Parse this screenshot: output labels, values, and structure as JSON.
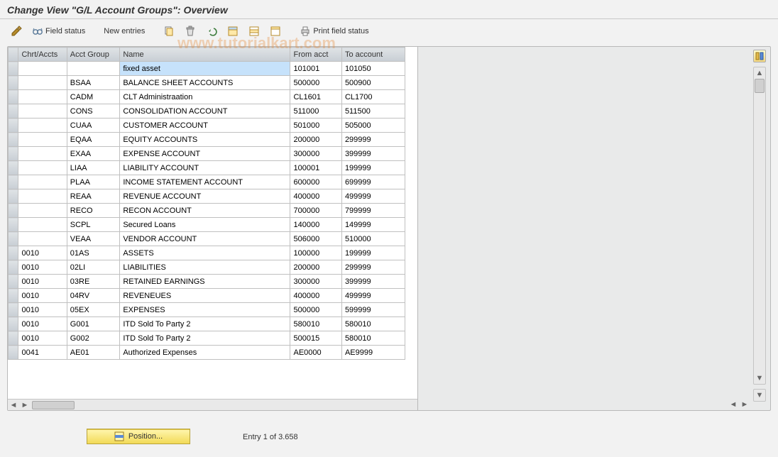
{
  "title": "Change View \"G/L Account Groups\": Overview",
  "toolbar": {
    "field_status": "Field status",
    "new_entries": "New entries",
    "print_field_status": "Print field status"
  },
  "icons": {
    "other_view": "other-view",
    "field_status": "glasses",
    "copy": "copy",
    "delete": "delete",
    "undo": "undo",
    "select_all": "select-all",
    "select_block": "select-block",
    "deselect_all": "deselect-all",
    "print": "print",
    "config": "configure-columns",
    "position": "position"
  },
  "columns": {
    "chrt": "Chrt/Accts",
    "grp": "Acct Group",
    "name": "Name",
    "from": "From acct",
    "to": "To account"
  },
  "rows": [
    {
      "chrt": "",
      "grp": "",
      "name": "fixed asset",
      "from": "101001",
      "to": "101050",
      "sel_name": true
    },
    {
      "chrt": "",
      "grp": "BSAA",
      "name": "BALANCE SHEET ACCOUNTS",
      "from": "500000",
      "to": "500900"
    },
    {
      "chrt": "",
      "grp": "CADM",
      "name": "CLT Administraation",
      "from": "CL1601",
      "to": "CL1700"
    },
    {
      "chrt": "",
      "grp": "CONS",
      "name": "CONSOLIDATION ACCOUNT",
      "from": "511000",
      "to": "511500"
    },
    {
      "chrt": "",
      "grp": "CUAA",
      "name": "CUSTOMER ACCOUNT",
      "from": "501000",
      "to": "505000"
    },
    {
      "chrt": "",
      "grp": "EQAA",
      "name": "EQUITY ACCOUNTS",
      "from": "200000",
      "to": "299999"
    },
    {
      "chrt": "",
      "grp": "EXAA",
      "name": "EXPENSE ACCOUNT",
      "from": "300000",
      "to": "399999"
    },
    {
      "chrt": "",
      "grp": "LIAA",
      "name": "LIABILITY ACCOUNT",
      "from": "100001",
      "to": "199999"
    },
    {
      "chrt": "",
      "grp": "PLAA",
      "name": "INCOME STATEMENT ACCOUNT",
      "from": "600000",
      "to": "699999"
    },
    {
      "chrt": "",
      "grp": "REAA",
      "name": "REVENUE ACCOUNT",
      "from": "400000",
      "to": "499999"
    },
    {
      "chrt": "",
      "grp": "RECO",
      "name": "RECON ACCOUNT",
      "from": "700000",
      "to": "799999"
    },
    {
      "chrt": "",
      "grp": "SCPL",
      "name": "Secured Loans",
      "from": "140000",
      "to": "149999"
    },
    {
      "chrt": "",
      "grp": "VEAA",
      "name": "VENDOR ACCOUNT",
      "from": "506000",
      "to": "510000"
    },
    {
      "chrt": "0010",
      "grp": "01AS",
      "name": "ASSETS",
      "from": "100000",
      "to": "199999"
    },
    {
      "chrt": "0010",
      "grp": "02LI",
      "name": "LIABILITIES",
      "from": "200000",
      "to": "299999"
    },
    {
      "chrt": "0010",
      "grp": "03RE",
      "name": "RETAINED EARNINGS",
      "from": "300000",
      "to": "399999"
    },
    {
      "chrt": "0010",
      "grp": "04RV",
      "name": "REVENEUES",
      "from": "400000",
      "to": "499999"
    },
    {
      "chrt": "0010",
      "grp": "05EX",
      "name": "EXPENSES",
      "from": "500000",
      "to": "599999"
    },
    {
      "chrt": "0010",
      "grp": "G001",
      "name": "ITD Sold To Party 2",
      "from": "580010",
      "to": "580010"
    },
    {
      "chrt": "0010",
      "grp": "G002",
      "name": "ITD Sold To Party 2",
      "from": "500015",
      "to": "580010"
    },
    {
      "chrt": "0041",
      "grp": "AE01",
      "name": "Authorized Expenses",
      "from": "AE0000",
      "to": "AE9999"
    }
  ],
  "position_button": "Position...",
  "entry_info": "Entry 1 of 3.658",
  "watermark": "www.tutorialkart.com"
}
